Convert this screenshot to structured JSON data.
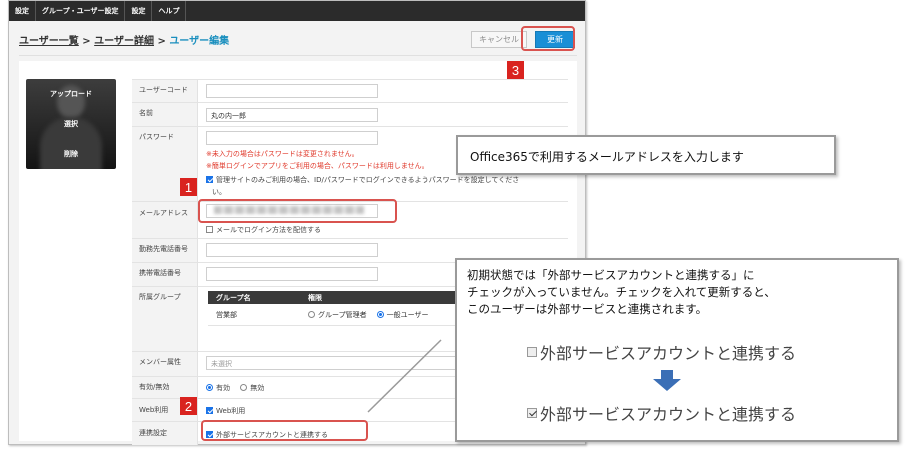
{
  "menubar": {
    "items": [
      "設定",
      "グループ・ユーザー設定",
      "設定",
      "ヘルプ"
    ]
  },
  "breadcrumb": {
    "item1": "ユーザー一覧",
    "sep1": " > ",
    "item2": "ユーザー詳細",
    "sep2": " > ",
    "current": "ユーザー編集"
  },
  "actions": {
    "cancel_label": "キャンセル",
    "update_label": "更新"
  },
  "avatar": {
    "upload_label": "アップロード",
    "select_label": "選択",
    "delete_label": "削除"
  },
  "form": {
    "user_code_label": "ユーザーコード",
    "user_code_value": "",
    "name_label": "名前",
    "name_value": "丸の内一郎",
    "password_label": "パスワード",
    "password_note1": "※未入力の場合はパスワードは変更されません。",
    "password_note2": "※簡単ログインでアプリをご利用の場合、パスワードは利用しません。",
    "admin_only_label": "管理サイトのみご利用の場合、ID/パスワードでログインできるようパスワードを設定してくださ",
    "admin_only_label2": "い。",
    "email_label": "メールアドレス",
    "email_send_label": "メールでログイン方法を配信する",
    "work_phone_label": "勤務先電話番号",
    "mobile_phone_label": "携帯電話番号",
    "group_label": "所属グループ",
    "group_table": {
      "col_name": "グループ名",
      "col_role": "権限",
      "rows": [
        {
          "name": "営業部",
          "role_admin": "グループ管理者",
          "role_user": "一般ユーザー"
        }
      ]
    },
    "member_attr_label": "メンバー属性",
    "member_attr_placeholder": "未選択",
    "enabled_label": "有効/無効",
    "enabled_on": "有効",
    "enabled_off": "無効",
    "web_label": "Web利用",
    "web_checkbox": "Web利用",
    "link_label": "連携設定",
    "link_checkbox": "外部サービスアカウントと連携する"
  },
  "steps": {
    "step1": "1",
    "step2": "2",
    "step3": "3"
  },
  "callout1": {
    "text": "Office365で利用するメールアドレスを入力します"
  },
  "callout2": {
    "line1": "初期状態では「外部サービスアカウントと連携する」に",
    "line2": "チェックが入っていません。チェックを入れて更新すると、",
    "line3": "このユーザーは外部サービスと連携されます。",
    "before_label": "外部サービスアカウントと連携する",
    "after_label": "外部サービスアカウントと連携する"
  },
  "colors": {
    "accent": "#1a8fd6",
    "highlight": "#d9231f",
    "arrow": "#3b6fb6"
  }
}
